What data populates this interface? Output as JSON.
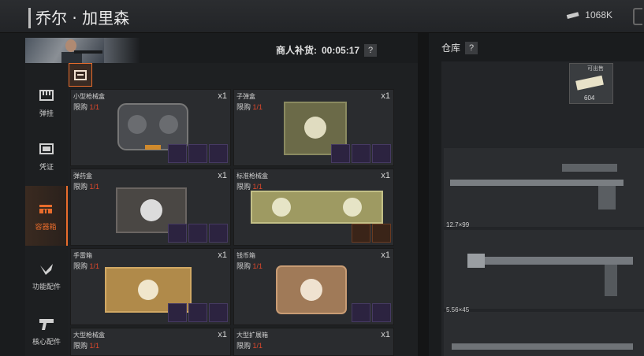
{
  "header": {
    "trader_name": "乔尔 · 加里森",
    "money": "1068K",
    "money_icon": "money-stack-icon"
  },
  "restock": {
    "label": "商人补货:",
    "timer": "00:05:17",
    "help": "?"
  },
  "warehouse": {
    "title": "仓库",
    "help": "?",
    "stash_item": {
      "caption": "可出售",
      "count": "604"
    }
  },
  "sidebar": {
    "items": [
      {
        "label": "弹挂",
        "icon": "magazine-icon"
      },
      {
        "label": "凭证",
        "icon": "voucher-icon"
      },
      {
        "label": "容器箱",
        "icon": "container-icon",
        "active": true
      },
      {
        "label": "功能配件",
        "icon": "attachment-icon"
      },
      {
        "label": "核心配件",
        "icon": "pistol-icon"
      }
    ]
  },
  "limit_label": "限购",
  "cards": [
    {
      "name": "小型枪械盒",
      "limit": "1/1",
      "qty": "x1"
    },
    {
      "name": "子弹盒",
      "limit": "1/1",
      "qty": "x1"
    },
    {
      "name": "弹药盒",
      "limit": "1/1",
      "qty": "x1"
    },
    {
      "name": "标准枪械盒",
      "limit": "1/1",
      "qty": "x1"
    },
    {
      "name": "手雷箱",
      "limit": "1/1",
      "qty": "x1"
    },
    {
      "name": "钱币箱",
      "limit": "1/1",
      "qty": "x1"
    },
    {
      "name": "大型枪械盒",
      "limit": "1/1",
      "qty": "x1"
    },
    {
      "name": "大型扩展箱",
      "limit": "1/1",
      "qty": "x1"
    }
  ],
  "calibers": [
    "12.7×99",
    "5.56×45"
  ],
  "colors": {
    "accent": "#e86c2c",
    "limit_value": "#e0482c"
  }
}
